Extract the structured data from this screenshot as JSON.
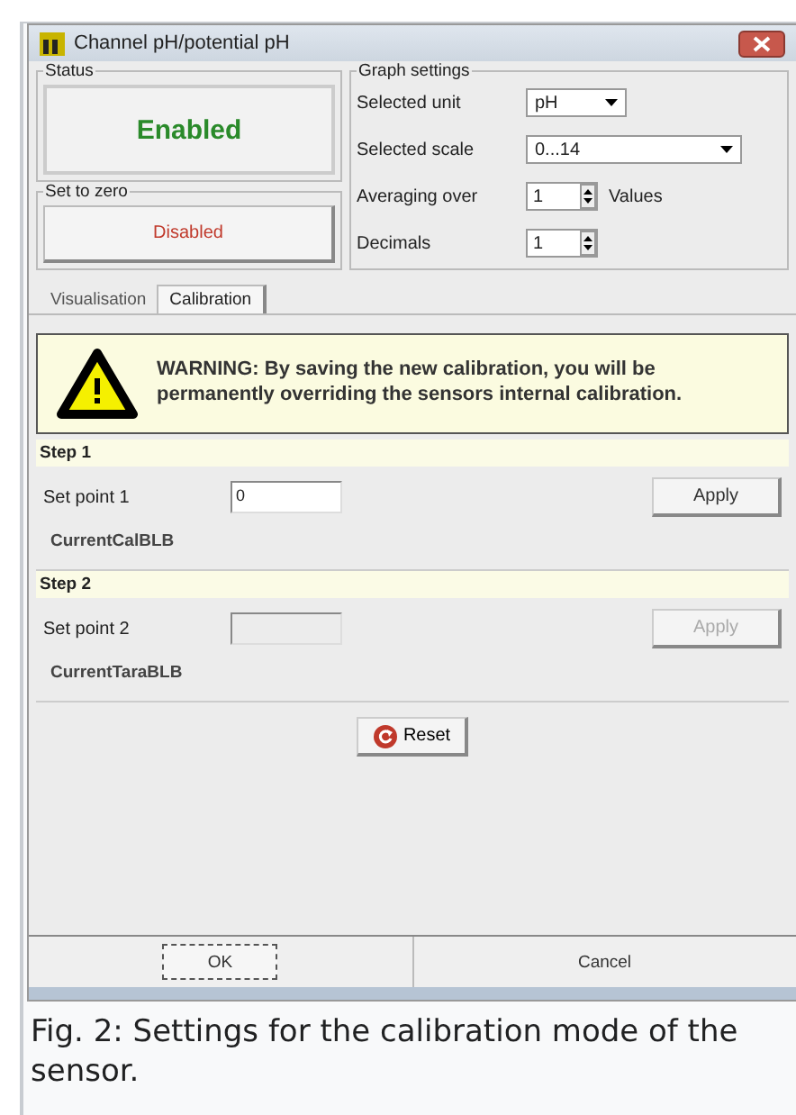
{
  "window": {
    "title": "Channel pH/potential pH"
  },
  "status": {
    "label": "Status",
    "value": "Enabled",
    "enabled": true
  },
  "set_to_zero": {
    "label": "Set to zero",
    "button": "Disabled",
    "enabled": false
  },
  "graph_settings": {
    "label": "Graph settings",
    "fields": [
      {
        "kind": "dropdown",
        "label": "Selected unit",
        "value": "pH"
      },
      {
        "kind": "dropdown",
        "label": "Selected scale",
        "value": "0...14"
      },
      {
        "kind": "spinner",
        "label": "Averaging over",
        "value": "1",
        "suffix": "Values"
      },
      {
        "kind": "spinner",
        "label": "Decimals",
        "value": "1"
      }
    ]
  },
  "tabs": [
    {
      "label": "Visualisation",
      "selected": false
    },
    {
      "label": "Calibration",
      "selected": true
    }
  ],
  "warning": {
    "text": "WARNING: By saving the new calibration, you will be permanently overriding the sensors internal calibration."
  },
  "steps": [
    {
      "title": "Step 1",
      "label": "Set point 1",
      "value": "0",
      "disabled": false,
      "button": "Apply",
      "info": "CurrentCalBLB"
    },
    {
      "title": "Step 2",
      "label": "Set point 2",
      "disabled": true,
      "button": "Apply",
      "info": "CurrentTaraBLB"
    }
  ],
  "reset_button": "Reset",
  "buttons": [
    {
      "label": "OK",
      "focused": true
    },
    {
      "label": "Cancel",
      "focused": false
    }
  ],
  "caption": "Fig. 2: Settings for the calibration mode of the sensor."
}
